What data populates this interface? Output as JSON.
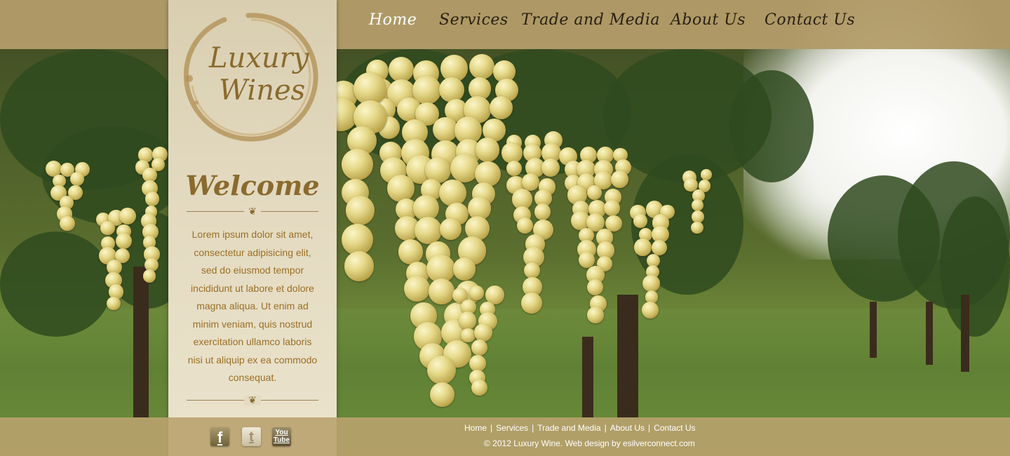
{
  "nav": {
    "items": [
      {
        "label": "Home",
        "active": true
      },
      {
        "label": "Services"
      },
      {
        "label": "Trade and Media"
      },
      {
        "label": "About Us"
      },
      {
        "label": "Contact Us"
      }
    ]
  },
  "logo": {
    "line1": "Luxury",
    "line2": "Wines"
  },
  "sidebar": {
    "heading": "Welcome",
    "ornament": "❦",
    "body": "Lorem ipsum dolor sit amet, consectetur adipisicing elit, sed do eiusmod tempor incididunt ut labore et dolore magna aliqua. Ut enim ad minim veniam, quis nostrud exercitation ullamco laboris nisi ut aliquip ex ea commodo consequat."
  },
  "social": {
    "facebook_icon": "facebook-icon",
    "twitter_icon": "twitter-icon",
    "youtube_icon": "youtube-icon",
    "facebook_glyph": "f",
    "twitter_glyph": "t",
    "youtube_glyph_1": "You",
    "youtube_glyph_2": "Tube"
  },
  "footer": {
    "links": [
      "Home",
      "Services",
      "Trade and Media",
      "About Us",
      "Contact Us"
    ],
    "separator": "|",
    "copyright": "© 2012 Luxury Wine. Web design by esilverconnect.com"
  },
  "colors": {
    "bar": "#b7a06c",
    "panel": "#e2d9bf",
    "gold_text": "#8a6a2e",
    "body_text": "#9b6f26"
  }
}
